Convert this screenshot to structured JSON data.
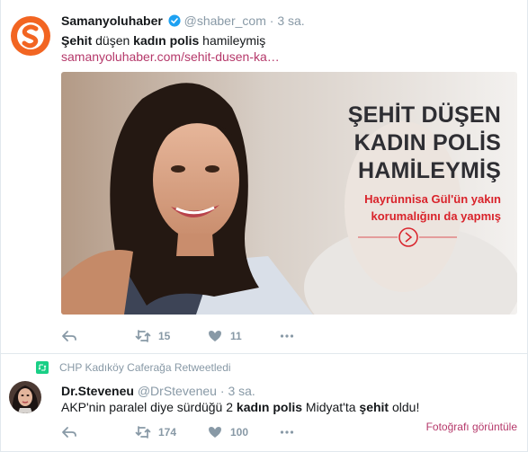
{
  "tweet1": {
    "display_name": "Samanyoluhaber",
    "handle": "@shaber_com",
    "separator": "·",
    "time": "3 sa.",
    "text_parts": [
      "Şehit",
      " düşen ",
      "kadın polis",
      " hamileymiş"
    ],
    "link": "samanyoluhaber.com/sehit-dusen-ka…",
    "card": {
      "title_lines": [
        "ŞEHİT DÜŞEN",
        "KADIN POLİS",
        "HAMİLEYMİŞ"
      ],
      "subtitle_lines": [
        "Hayrünnisa Gül'ün yakın",
        "korumalığını da yapmış"
      ]
    },
    "actions": {
      "retweets": "15",
      "likes": "11"
    }
  },
  "retweet_context": {
    "text": "CHP Kadıköy Caferağa Retweetledi"
  },
  "tweet2": {
    "display_name": "Dr.Steveneu",
    "handle": "@DrSteveneu",
    "separator": "·",
    "time": "3 sa.",
    "text_parts": [
      "AKP'nin paralel diye sürdüğü 2 ",
      "kadın polis",
      " Midyat'ta ",
      "şehit",
      " oldu!"
    ],
    "photo_link": "Fotoğrafı görüntüle",
    "actions": {
      "retweets": "174",
      "likes": "100"
    }
  },
  "colors": {
    "link": "#b5386a",
    "muted": "#8899a6",
    "brand_orange": "#f26522",
    "headline_red": "#d9232b",
    "retweet_green": "#19cf86"
  },
  "icons": [
    "reply-icon",
    "retweet-icon",
    "like-icon",
    "more-icon",
    "verified-icon"
  ]
}
